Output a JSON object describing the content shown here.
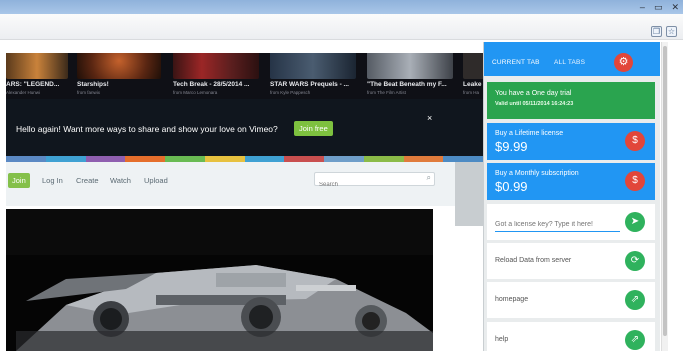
{
  "window": {
    "buttons": [
      "–",
      "▭",
      "✕"
    ],
    "toolbar_icons": [
      "copy-icon",
      "star-icon"
    ]
  },
  "videos": [
    {
      "title": "ARS: \"LEGEND...",
      "sub": "Alexander Hunwi"
    },
    {
      "title": "Starships!",
      "sub": "from fanwix"
    },
    {
      "title": "Tech Break - 28/5/2014 ...",
      "sub": "from Marco Lemonara"
    },
    {
      "title": "STAR WARS Prequels - ...",
      "sub": "from Kyle Pappesch"
    },
    {
      "title": "\"The Beat Beneath my F...",
      "sub": "from The Film Artist"
    },
    {
      "title": "Leake",
      "sub": "from Ha"
    }
  ],
  "banner": {
    "text": "Hello again! Want more ways to share and show your love on Vimeo?",
    "join_label": "Join free",
    "close_label": "×"
  },
  "stripe_colors": [
    "#5b89c4",
    "#3fa1d3",
    "#8f5fb0",
    "#e56e2c",
    "#69bb53",
    "#e7c13f",
    "#3fa1d3",
    "#c94f4f",
    "#6f9ec9",
    "#8bbb48",
    "#e07b3c",
    "#4d8bc4"
  ],
  "site_nav": {
    "join": "Join",
    "links": [
      "Log In",
      "Create",
      "Watch",
      "Upload"
    ],
    "search_placeholder": "Search"
  },
  "popup": {
    "tabs": [
      "CURRENT TAB",
      "ALL TABS"
    ],
    "trial": {
      "title": "You have a One day trial",
      "sub": "Valid until 05/11/2014 16:24:23"
    },
    "lifetime": {
      "title": "Buy a Lifetime license",
      "price": "$9.99",
      "icon": "$"
    },
    "monthly": {
      "title": "Buy a Monthly subscription",
      "price": "$0.99",
      "icon": "$"
    },
    "license_placeholder": "Got a license key? Type it here!",
    "reload": "Reload Data from server",
    "homepage": "homepage",
    "help": "help",
    "colors": {
      "header": "#2196f3",
      "trial": "#2aa44f",
      "buy": "#2196f3",
      "danger": "#e2463a",
      "action": "#2fb25d"
    }
  }
}
